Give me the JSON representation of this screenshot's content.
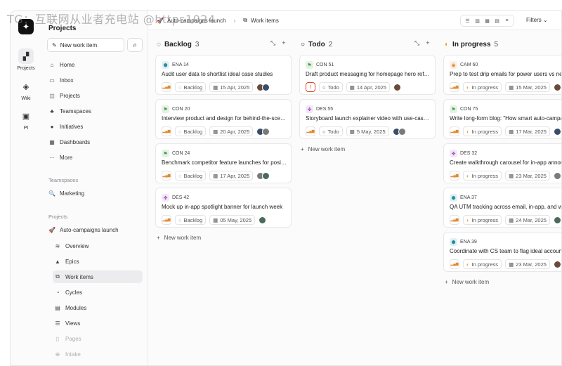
{
  "watermark": "TG：互联网从业者充电站 @https1024",
  "rail": [
    {
      "label": "Projects",
      "icon": "projects-icon"
    },
    {
      "label": "Wiki",
      "icon": "wiki-icon"
    },
    {
      "label": "PI",
      "icon": "pi-icon"
    }
  ],
  "sidebar": {
    "title": "Projects",
    "new_work_item": "New work item",
    "nav": [
      {
        "label": "Home",
        "icon": "home-icon"
      },
      {
        "label": "Inbox",
        "icon": "inbox-icon"
      },
      {
        "label": "Projects",
        "icon": "projects-icon"
      },
      {
        "label": "Teamspaces",
        "icon": "teamspaces-icon"
      },
      {
        "label": "Initiatives",
        "icon": "initiatives-icon"
      },
      {
        "label": "Dashboards",
        "icon": "dashboards-icon"
      },
      {
        "label": "More",
        "icon": "more-icon"
      }
    ],
    "teamspaces_label": "Teamspaces",
    "teamspaces": [
      {
        "label": "Marketing",
        "icon": "marketing-icon"
      }
    ],
    "projects_label": "Projects",
    "project": {
      "label": "Auto-campaigns launch",
      "icon": "rocket-icon"
    },
    "project_items": [
      {
        "label": "Overview",
        "icon": "overview-icon"
      },
      {
        "label": "Epics",
        "icon": "epics-icon"
      },
      {
        "label": "Work items",
        "icon": "work-items-icon",
        "active": true
      },
      {
        "label": "Cycles",
        "icon": "cycles-icon"
      },
      {
        "label": "Modules",
        "icon": "modules-icon"
      },
      {
        "label": "Views",
        "icon": "views-icon"
      },
      {
        "label": "Pages",
        "icon": "pages-icon",
        "faded": true
      },
      {
        "label": "Intake",
        "icon": "intake-icon",
        "faded": true
      }
    ]
  },
  "topbar": {
    "project": "Auto-campaigns launch",
    "page": "Work items",
    "filters": "Filters"
  },
  "columns": [
    {
      "name": "Backlog",
      "count": "3",
      "status_icon": "backlog-icon",
      "new_label": "New work item",
      "cards": [
        {
          "id": "ENA 14",
          "type": "ena",
          "title": "Audit user data to shortlist ideal case studies",
          "state": "Backlog",
          "date": "15 Apr, 2025",
          "avatars": 2
        },
        {
          "id": "CON 20",
          "type": "con",
          "title": "Interview product and design for behind-the-scenes",
          "state": "Backlog",
          "date": "20 Apr, 2025",
          "avatars": 2
        },
        {
          "id": "CON 24",
          "type": "con",
          "title": "Benchmark competitor feature launches for positioning",
          "state": "Backlog",
          "date": "17 Apr, 2025",
          "avatars": 2
        },
        {
          "id": "DES 42",
          "type": "des",
          "title": "Mock up in-app spotlight banner for launch week",
          "state": "Backlog",
          "date": "05 May, 2025",
          "avatars": 1
        }
      ]
    },
    {
      "name": "Todo",
      "count": "2",
      "status_icon": "todo-icon",
      "new_label": "New work item",
      "cards": [
        {
          "id": "CON 51",
          "type": "con",
          "title": "Draft product messaging for homepage hero refresh",
          "state": "Todo",
          "date": "14 Apr, 2025",
          "avatars": 1,
          "urgent": true
        },
        {
          "id": "DES 55",
          "type": "des",
          "title": "Storyboard launch explainer video with use-case demos",
          "state": "Todo",
          "date": "5 May, 2025",
          "avatars": 2
        }
      ]
    },
    {
      "name": "In progress",
      "count": "5",
      "status_icon": "in-progress-icon",
      "new_label": "New work item",
      "cards": [
        {
          "id": "CAM 60",
          "type": "cam",
          "title": "Prep to test drip emails for power users vs new",
          "state": "In progress",
          "date": "15 Mar, 2025",
          "avatars": 1
        },
        {
          "id": "CON 75",
          "type": "con",
          "title": "Write long-form blog: \"How smart auto-campaigns",
          "state": "In progress",
          "date": "17 Mar, 2025",
          "avatars": 1
        },
        {
          "id": "DES 32",
          "type": "des",
          "title": "Create walkthrough carousel for in-app announce",
          "state": "In progress",
          "date": "23 Mar, 2025",
          "avatars": 1
        },
        {
          "id": "ENA 37",
          "type": "ena",
          "title": "QA UTM tracking across email, in-app, and web",
          "state": "In progress",
          "date": "24 Mar, 2025",
          "avatars": 1
        },
        {
          "id": "ENA 39",
          "type": "ena",
          "title": "Coordinate with CS team to flag ideal accounts",
          "state": "In progress",
          "date": "23 Mar, 2025",
          "avatars": 1
        }
      ]
    }
  ],
  "colors": {
    "ena": "#2b8fa8",
    "con": "#3e9a3e",
    "des": "#a34fc4",
    "cam": "#e08a2e",
    "urgent": "#d9442b"
  }
}
